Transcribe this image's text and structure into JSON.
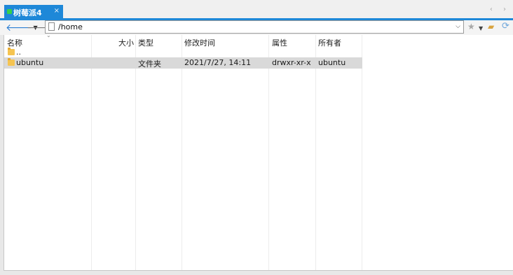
{
  "tab": {
    "title": "树莓派4",
    "close": "×"
  },
  "tab_nav": {
    "arrows": "‹ ›"
  },
  "toolbar": {
    "back_icon": "arrow-left-icon",
    "forward_icon": "arrow-right-icon",
    "path": "/home",
    "dropdown_glyph": "⌵"
  },
  "columns": {
    "name": "名称",
    "size": "大小",
    "type": "类型",
    "modified": "修改时间",
    "attributes": "属性",
    "owner": "所有者"
  },
  "rows": [
    {
      "name": "..",
      "size": "",
      "type": "",
      "modified": "",
      "attributes": "",
      "owner": ""
    },
    {
      "name": "ubuntu",
      "size": "",
      "type": "文件夹",
      "modified": "2021/7/27, 14:11",
      "attributes": "drwxr-xr-x",
      "owner": "ubuntu"
    }
  ],
  "colors": {
    "accent": "#1e88d8",
    "selected_row": "#d9d9d9",
    "folder": "#f5c451"
  }
}
